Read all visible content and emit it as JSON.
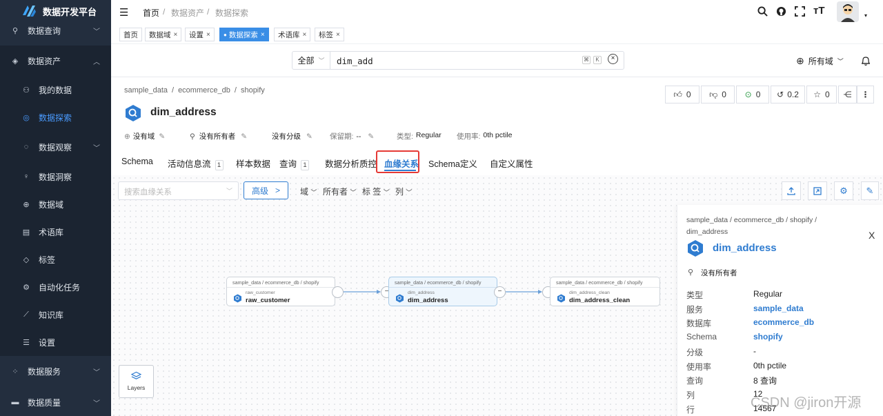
{
  "app": {
    "title": "数据开发平台"
  },
  "sidebar": {
    "items": [
      {
        "label": "数据查询",
        "icon": "search-icon"
      },
      {
        "label": "数据资产",
        "icon": "database-icon"
      },
      {
        "label": "我的数据",
        "icon": "user-data-icon"
      },
      {
        "label": "数据探索",
        "icon": "globe-icon"
      },
      {
        "label": "数据观察",
        "icon": "chat-icon"
      },
      {
        "label": "数据洞察",
        "icon": "bulb-icon"
      },
      {
        "label": "数据域",
        "icon": "globe-icon"
      },
      {
        "label": "术语库",
        "icon": "book-icon"
      },
      {
        "label": "标签",
        "icon": "tag-icon"
      },
      {
        "label": "自动化任务",
        "icon": "robot-icon"
      },
      {
        "label": "知识库",
        "icon": "chart-icon"
      },
      {
        "label": "设置",
        "icon": "sliders-icon"
      },
      {
        "label": "数据服务",
        "icon": "service-icon"
      },
      {
        "label": "数据质量",
        "icon": "quality-icon"
      }
    ]
  },
  "topbar": {
    "breadcrumb": [
      "首页",
      "数据资产",
      "数据探索"
    ],
    "sep": "/"
  },
  "tabs": [
    {
      "label": "首页",
      "closable": false
    },
    {
      "label": "数据域",
      "closable": true
    },
    {
      "label": "设置",
      "closable": true
    },
    {
      "label": "数据探索",
      "closable": true,
      "active": true
    },
    {
      "label": "术语库",
      "closable": true
    },
    {
      "label": "标签",
      "closable": true
    }
  ],
  "close_glyph": "×",
  "search": {
    "scope": "全部",
    "value": "dim_add",
    "kbd1": "⌘",
    "kbd2": "K",
    "domain": "所有域"
  },
  "entity": {
    "breadcrumb": [
      "sample_data",
      "ecommerce_db",
      "shopify"
    ],
    "name": "dim_address",
    "stats": {
      "likes": "0",
      "dislikes": "0",
      "tasks": "0",
      "version": "0.2",
      "stars": "0"
    },
    "meta": {
      "domain": "没有域",
      "owner": "没有所有者",
      "tier": "没有分级",
      "retention_label": "保留期:",
      "retention_value": "--",
      "type_label": "类型:",
      "type_value": "Regular",
      "usage_label": "使用率:",
      "usage_value": "0th pctile"
    }
  },
  "page_tabs": [
    {
      "label": "Schema"
    },
    {
      "label": "活动信息流",
      "badge": "1"
    },
    {
      "label": "样本数据"
    },
    {
      "label": "查询",
      "badge": "1"
    },
    {
      "label": "数据分析质控"
    },
    {
      "label": "血缘关系",
      "active": true
    },
    {
      "label": "Schema定义"
    },
    {
      "label": "自定义属性"
    }
  ],
  "lineage": {
    "search_placeholder": "搜索血缘关系",
    "advanced": "高级",
    "advanced_arrow": ">",
    "filters": [
      "域",
      "所有者",
      "标 签",
      "列"
    ],
    "layers": "Layers",
    "nodes": [
      {
        "path": "sample_data / ecommerce_db / shopify",
        "small": "raw_customer",
        "name": "raw_customer"
      },
      {
        "path": "sample_data / ecommerce_db / shopify",
        "small": "dim_address",
        "name": "dim_address"
      },
      {
        "path": "sample_data / ecommerce_db / shopify",
        "small": "dim_address_clean",
        "name": "dim_address_clean"
      }
    ]
  },
  "panel": {
    "breadcrumb": "sample_data / ecommerce_db / shopify /",
    "breadcrumb2": "dim_address",
    "name": "dim_address",
    "owner": "没有所有者",
    "close": "X",
    "rows": [
      {
        "label": "类型",
        "value": "Regular",
        "link": false
      },
      {
        "label": "服务",
        "value": "sample_data",
        "link": true
      },
      {
        "label": "数据库",
        "value": "ecommerce_db",
        "link": true
      },
      {
        "label": "Schema",
        "value": "shopify",
        "link": true
      },
      {
        "label": "分级",
        "value": "-",
        "link": false
      },
      {
        "label": "使用率",
        "value": "0th pctile",
        "link": false
      },
      {
        "label": "查询",
        "value": "8 查询",
        "link": false
      },
      {
        "label": "列",
        "value": "12",
        "link": false
      },
      {
        "label": "行",
        "value": "14567",
        "link": false
      }
    ]
  },
  "watermark": "CSDN @jiron开源",
  "colors": {
    "accent": "#2f7cd0",
    "sidebar": "#232e3e",
    "highlight": "#e53935"
  }
}
